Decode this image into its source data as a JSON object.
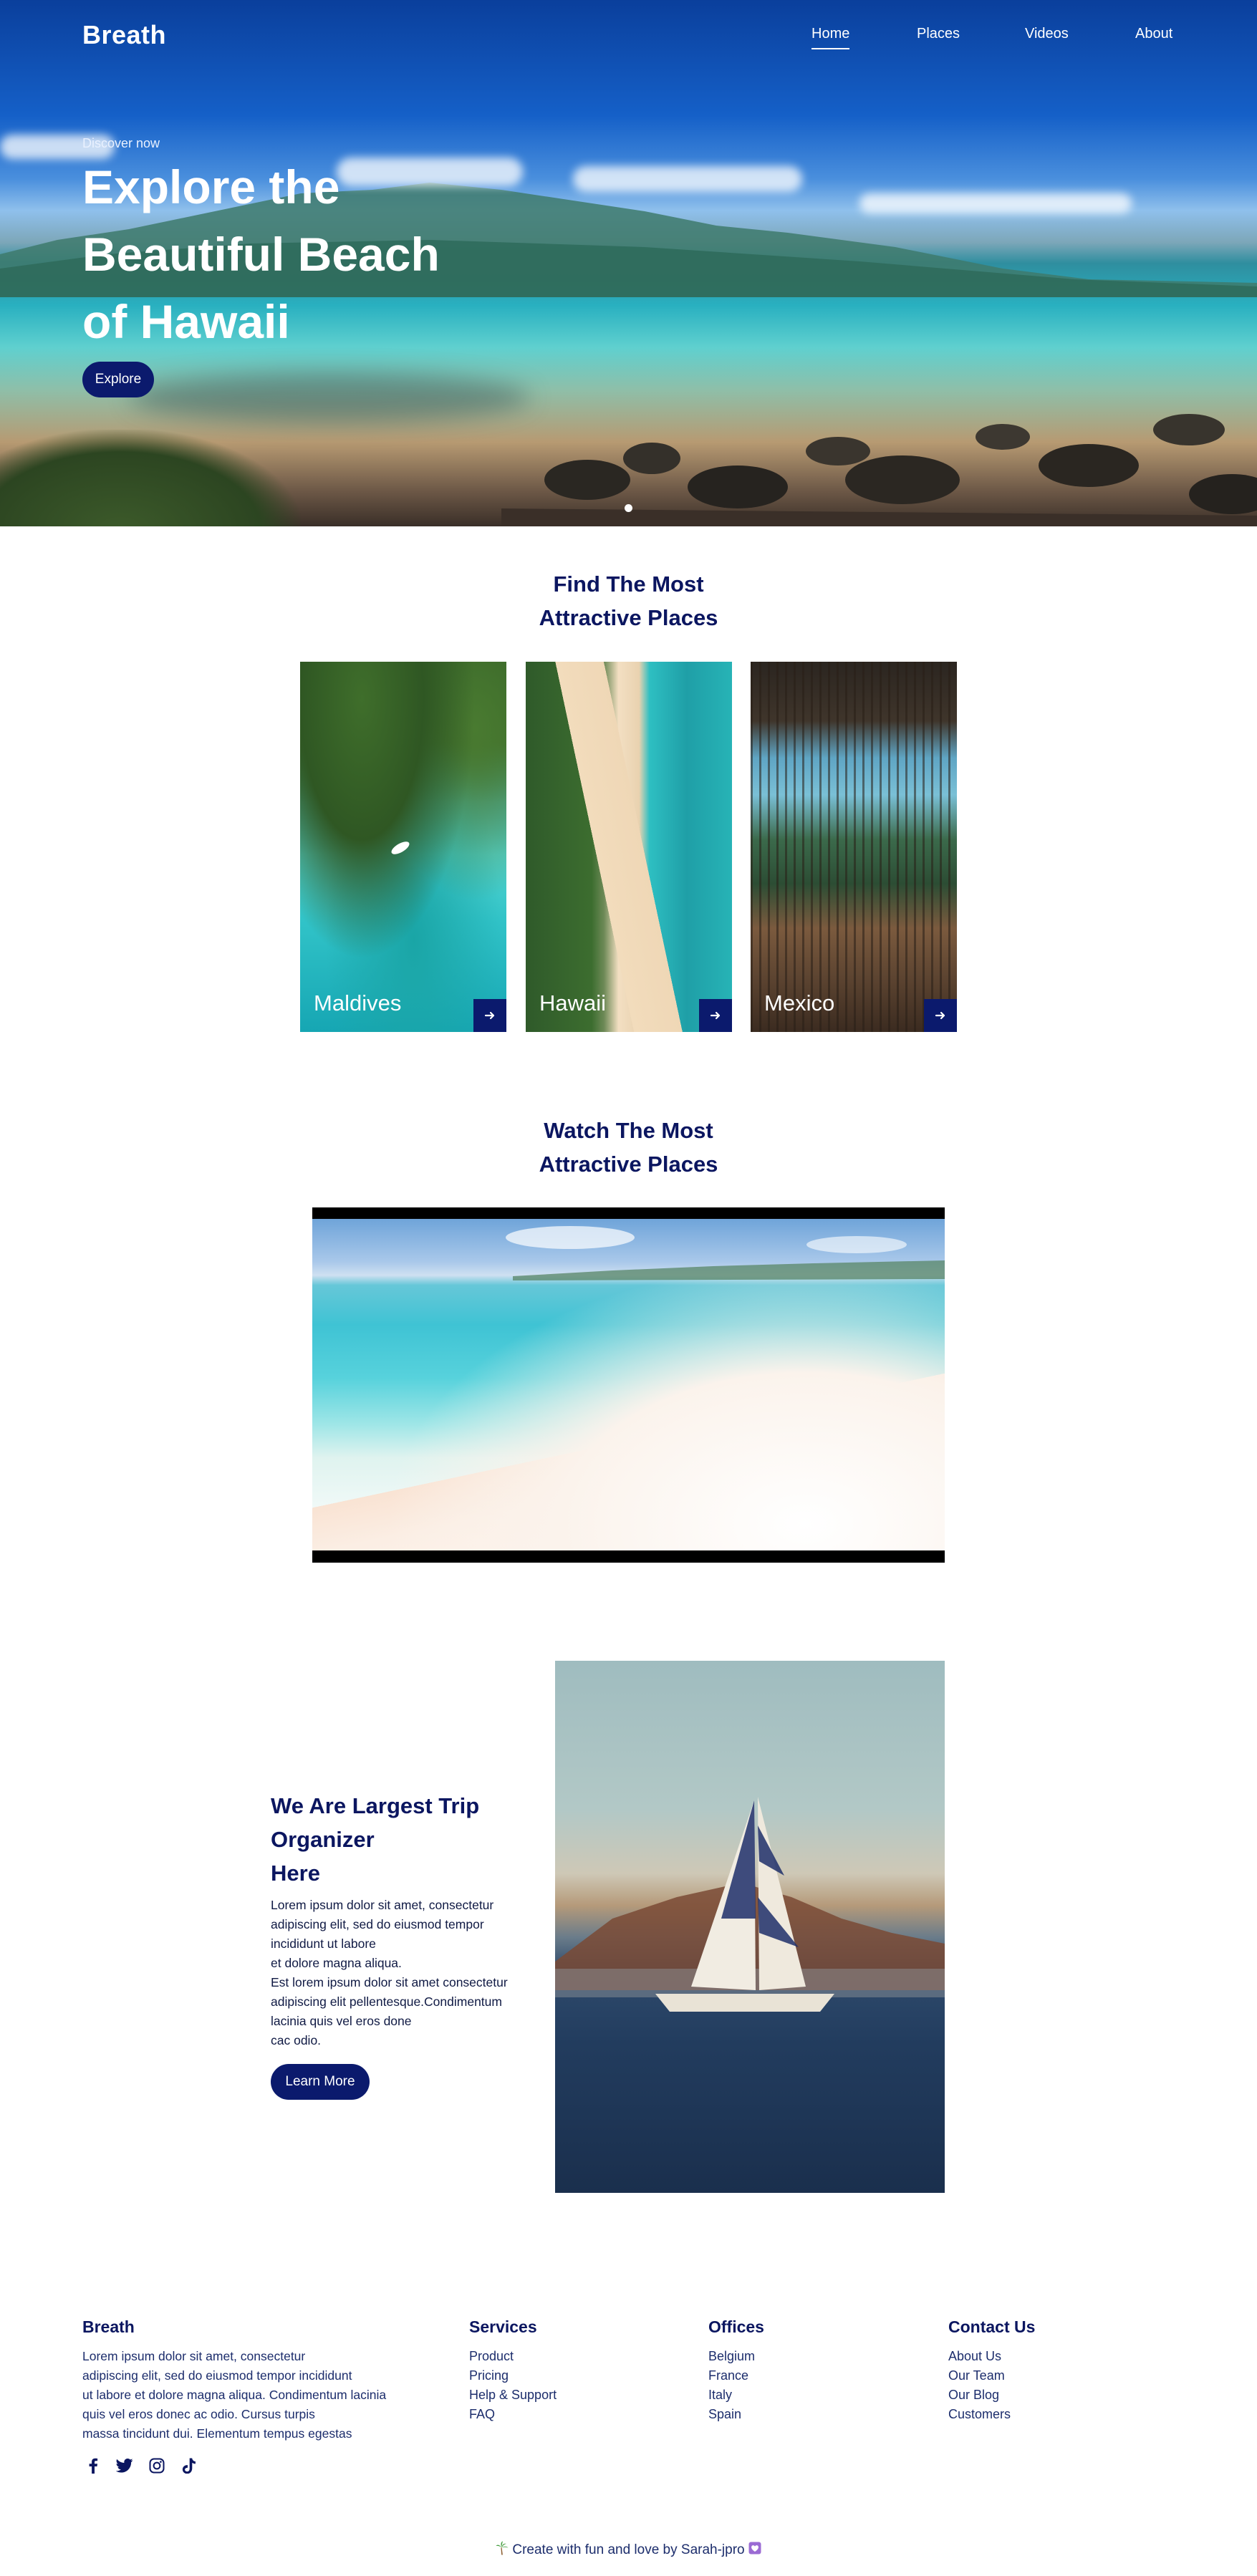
{
  "brand": {
    "logo": "Breath"
  },
  "nav": {
    "items": [
      "Home",
      "Places",
      "Videos",
      "About"
    ],
    "active": "Home"
  },
  "hero": {
    "eyebrow": "Discover now",
    "title_lines": [
      "Explore the",
      "Beautiful Beach",
      "of Hawaii"
    ],
    "cta": "Explore",
    "carousel_dots": 1
  },
  "places": {
    "title_lines": [
      "Find The Most",
      "Attractive Places"
    ],
    "cards": [
      {
        "label": "Maldives",
        "icon": "arrow-right-icon"
      },
      {
        "label": "Hawaii",
        "icon": "arrow-right-icon"
      },
      {
        "label": "Mexico",
        "icon": "arrow-right-icon"
      }
    ]
  },
  "videos": {
    "title_lines": [
      "Watch The Most",
      "Attractive Places"
    ]
  },
  "about": {
    "title_lines": [
      "We Are Largest Trip",
      "Organizer",
      "Here"
    ],
    "body_lines": [
      "Lorem ipsum dolor sit amet, consectetur",
      "adipiscing elit, sed do eiusmod tempor",
      "incididunt ut labore",
      "et dolore magna aliqua.",
      "Est lorem ipsum dolor sit amet consectetur",
      "adipiscing elit pellentesque.Condimentum",
      "lacinia quis vel eros done",
      "cac odio."
    ],
    "cta": "Learn More"
  },
  "footer": {
    "brand": {
      "title": "Breath",
      "lines": [
        "Lorem ipsum dolor sit amet, consectetur",
        "adipiscing elit, sed do eiusmod tempor incididunt",
        "ut labore et dolore magna aliqua. Condimentum lacinia",
        "quis vel eros donec ac odio. Cursus turpis",
        "massa tincidunt dui. Elementum tempus egestas"
      ]
    },
    "services": {
      "title": "Services",
      "links": [
        "Product",
        "Pricing",
        "Help & Support",
        "FAQ"
      ]
    },
    "offices": {
      "title": "Offices",
      "links": [
        "Belgium",
        "France",
        "Italy",
        "Spain"
      ]
    },
    "contact": {
      "title": "Contact Us",
      "links": [
        "About Us",
        "Our Team",
        "Our Blog",
        "Customers"
      ]
    },
    "socials": [
      "facebook-icon",
      "twitter-icon",
      "instagram-icon",
      "tiktok-icon"
    ],
    "credit": "Create with fun and love by Sarah-jpro"
  },
  "colors": {
    "navy": "#0b1a6d",
    "heading": "#0b1660",
    "white": "#ffffff"
  }
}
